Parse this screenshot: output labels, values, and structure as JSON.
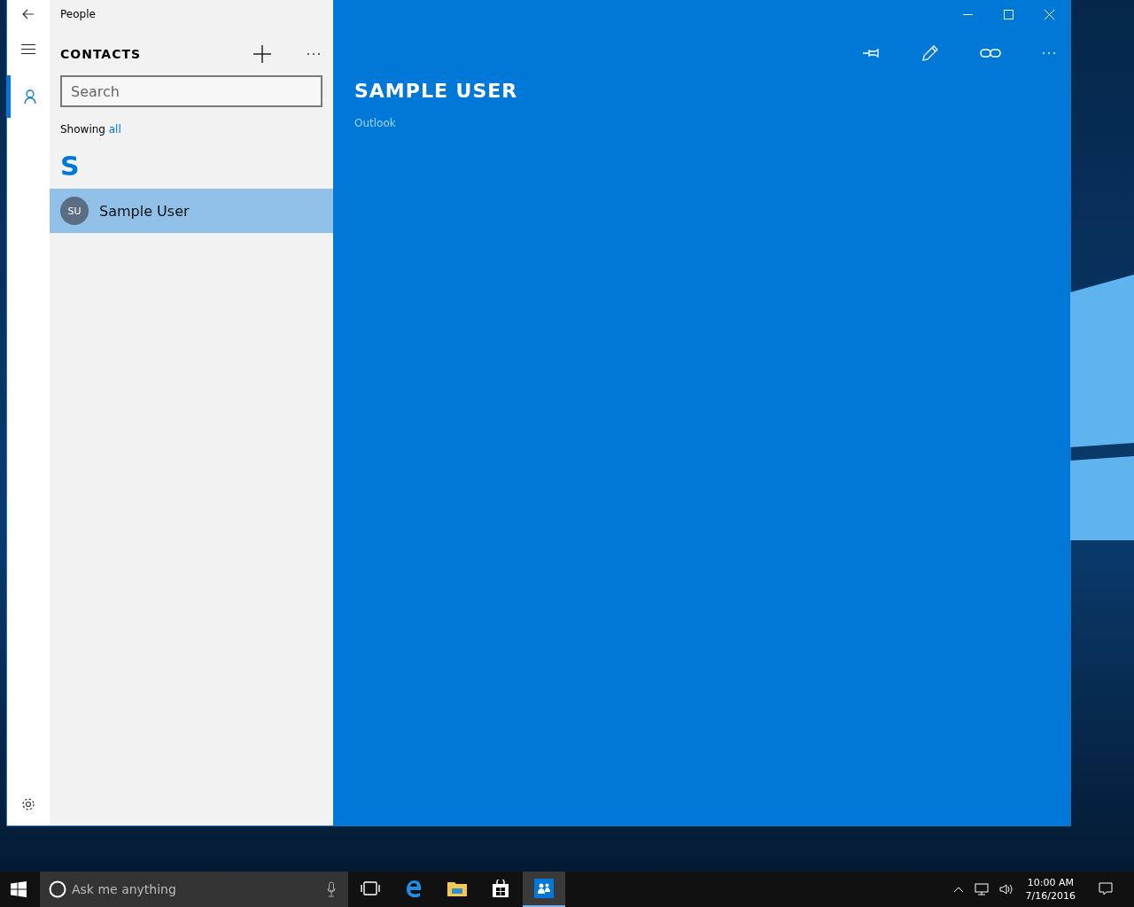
{
  "window": {
    "title": "People"
  },
  "nav": {
    "items": [
      {
        "kind": "contacts",
        "selected": true
      }
    ]
  },
  "contacts": {
    "heading": "CONTACTS",
    "search": {
      "placeholder": "Search"
    },
    "filter": {
      "label": "Showing",
      "value": "all"
    },
    "groups": [
      {
        "letter": "S",
        "contacts": [
          {
            "initials": "SU",
            "name": "Sample User",
            "selected": true
          }
        ]
      }
    ]
  },
  "detail": {
    "name": "SAMPLE USER",
    "source": "Outlook"
  },
  "taskbar": {
    "search_placeholder": "Ask me anything",
    "apps": [
      {
        "kind": "task-view",
        "active": false
      },
      {
        "kind": "edge",
        "active": false
      },
      {
        "kind": "explorer",
        "active": false
      },
      {
        "kind": "store",
        "active": false
      },
      {
        "kind": "people",
        "active": true
      }
    ],
    "time": "10:00 AM",
    "date": "7/16/2016"
  }
}
